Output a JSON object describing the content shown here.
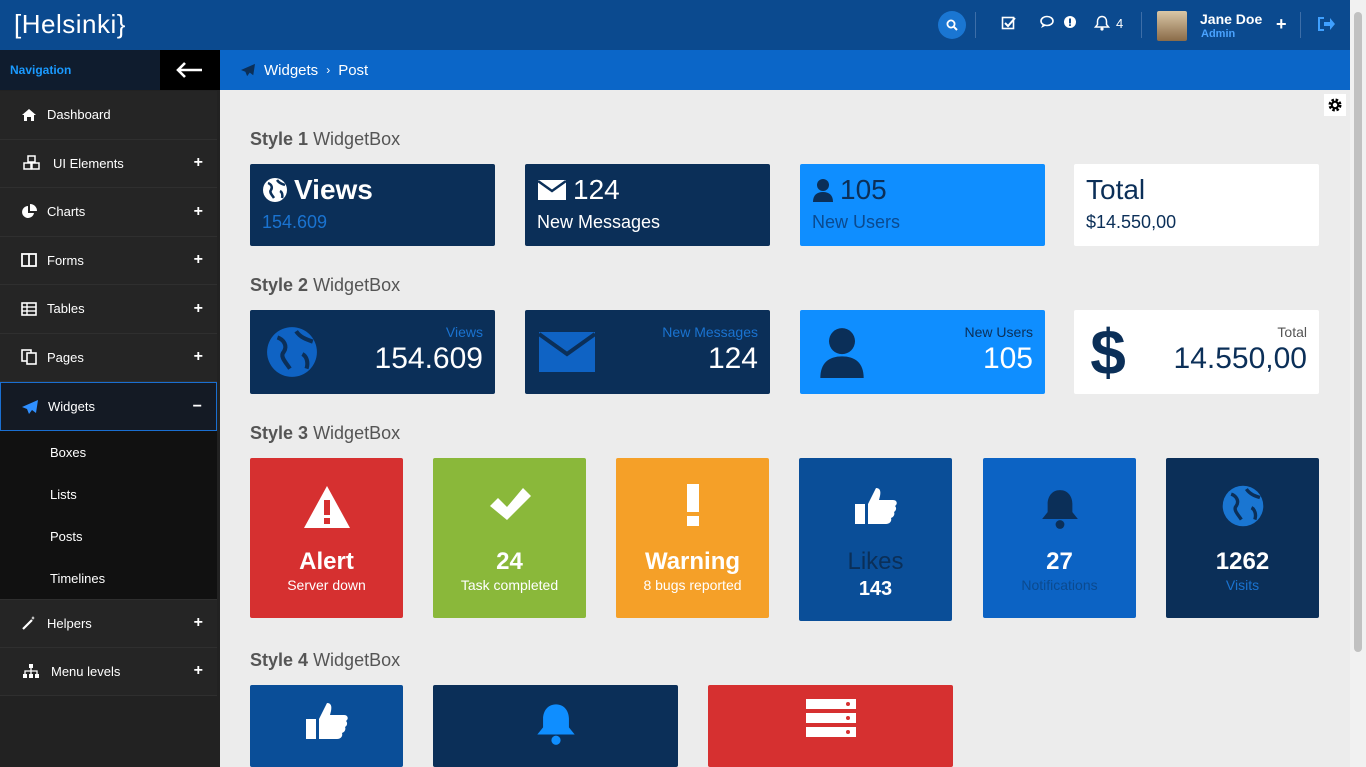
{
  "app": {
    "logo": "[Helsinki}"
  },
  "topbar": {
    "notifications_count": "4",
    "user": {
      "name": "Jane Doe",
      "role": "Admin"
    },
    "icons": [
      "search-icon",
      "tasks-icon",
      "chat-icon",
      "bell-icon",
      "plus-icon",
      "logout-icon"
    ]
  },
  "sidebar": {
    "title": "Navigation",
    "items": [
      {
        "label": "Dashboard",
        "icon": "home-icon"
      },
      {
        "label": "UI Elements",
        "icon": "cubes-icon"
      },
      {
        "label": "Charts",
        "icon": "pie-chart-icon"
      },
      {
        "label": "Forms",
        "icon": "columns-icon"
      },
      {
        "label": "Tables",
        "icon": "table-icon"
      },
      {
        "label": "Pages",
        "icon": "pages-icon"
      },
      {
        "label": "Widgets",
        "icon": "paper-plane-icon"
      },
      {
        "label": "Helpers",
        "icon": "magic-wand-icon"
      },
      {
        "label": "Menu levels",
        "icon": "sitemap-icon"
      }
    ],
    "widgets_sub": [
      "Boxes",
      "Lists",
      "Posts",
      "Timelines"
    ]
  },
  "breadcrumb": {
    "section": "Widgets",
    "page": "Post"
  },
  "sections": {
    "s1": {
      "num": "Style 1",
      "name": "WidgetBox"
    },
    "s2": {
      "num": "Style 2",
      "name": "WidgetBox"
    },
    "s3": {
      "num": "Style 3",
      "name": "WidgetBox"
    },
    "s4": {
      "num": "Style 4",
      "name": "WidgetBox"
    }
  },
  "style1": [
    {
      "big": "Views",
      "small": "154.609",
      "icon": "globe-icon"
    },
    {
      "big": "124",
      "small": "New Messages",
      "icon": "envelope-icon"
    },
    {
      "big": "105",
      "small": "New Users",
      "icon": "user-icon"
    },
    {
      "big": "Total",
      "small": "$14.550,00"
    }
  ],
  "style2": [
    {
      "label": "Views",
      "value": "154.609",
      "icon": "globe-icon"
    },
    {
      "label": "New Messages",
      "value": "124",
      "icon": "envelope-icon"
    },
    {
      "label": "New Users",
      "value": "105",
      "icon": "user-icon"
    },
    {
      "label": "Total",
      "value": "14.550,00",
      "icon": "dollar-icon"
    }
  ],
  "style3": [
    {
      "head": "Alert",
      "sub": "Server down",
      "icon": "warning-icon"
    },
    {
      "head": "24",
      "sub": "Task completed",
      "icon": "check-icon"
    },
    {
      "head": "Warning",
      "sub": "8 bugs reported",
      "icon": "exclamation-icon"
    },
    {
      "head": "Likes",
      "sub": "143",
      "icon": "thumbs-up-icon"
    },
    {
      "head": "27",
      "sub": "Notifications",
      "icon": "bell-icon"
    },
    {
      "head": "1262",
      "sub": "Visits",
      "icon": "globe-icon"
    }
  ],
  "colors": {
    "topbar": "#0b4a8f",
    "breadcrumb": "#0b66c8",
    "navy": "#0b2f58",
    "blue": "#0f8eff",
    "red": "#d63030",
    "green": "#8ab83a",
    "orange": "#f5a028"
  }
}
